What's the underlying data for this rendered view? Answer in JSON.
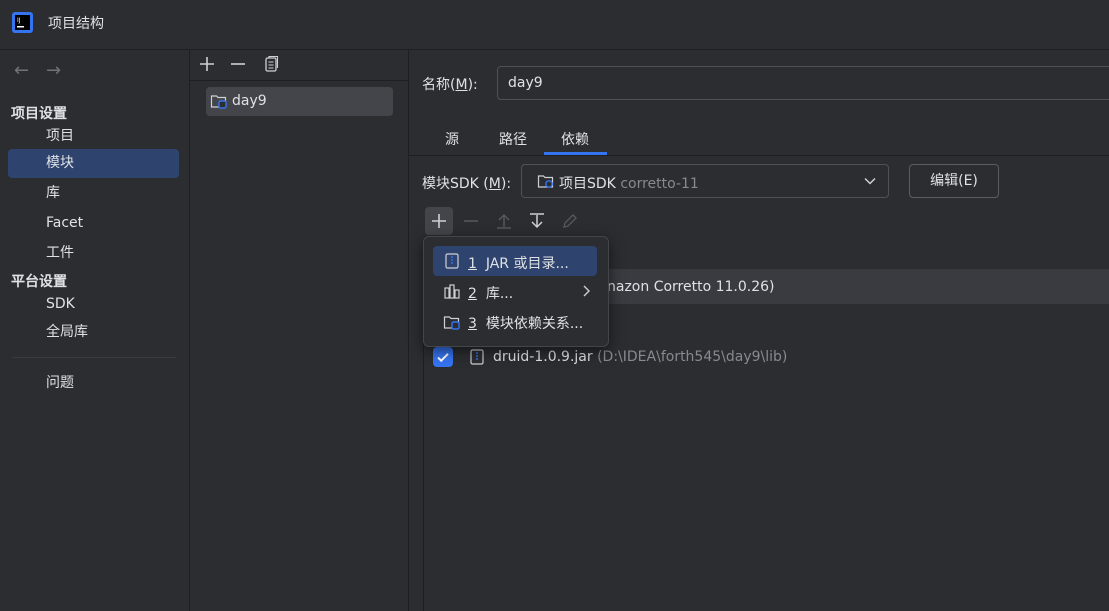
{
  "window": {
    "title": "项目结构"
  },
  "sidebar": {
    "section_project": "项目设置",
    "items_project": [
      {
        "label": "项目"
      },
      {
        "label": "模块"
      },
      {
        "label": "库"
      },
      {
        "label": "Facet"
      },
      {
        "label": "工件"
      }
    ],
    "section_platform": "平台设置",
    "items_platform": [
      {
        "label": "SDK"
      },
      {
        "label": "全局库"
      }
    ],
    "problems": "问题"
  },
  "modules": {
    "items": [
      {
        "label": "day9"
      }
    ]
  },
  "details": {
    "name_label_prefix": "名称(",
    "name_label_mnemonic": "M",
    "name_label_suffix": "):",
    "name_value": "day9",
    "tabs": [
      {
        "label": "源"
      },
      {
        "label": "路径"
      },
      {
        "label": "依赖"
      }
    ],
    "sdk_label_prefix": "模块SDK (",
    "sdk_label_mnemonic": "M",
    "sdk_label_suffix": "):",
    "sdk_value": "项目SDK",
    "sdk_version": "corretto-11",
    "edit_button": "编辑(E)"
  },
  "dependencies": {
    "jdk_row_text": "nazon Corretto 11.0.26)",
    "jar_name": "druid-1.0.9.jar",
    "jar_path": "(D:\\IDEA\\forth545\\day9\\lib)",
    "jar_checked": true
  },
  "popup_menu": {
    "items": [
      {
        "mnemonic": "1",
        "label": "JAR 或目录..."
      },
      {
        "mnemonic": "2",
        "label": "库..."
      },
      {
        "mnemonic": "3",
        "label": "模块依赖关系..."
      }
    ]
  },
  "colors": {
    "accent": "#3574f0",
    "selection": "#2e436e",
    "background": "#2b2d30"
  }
}
